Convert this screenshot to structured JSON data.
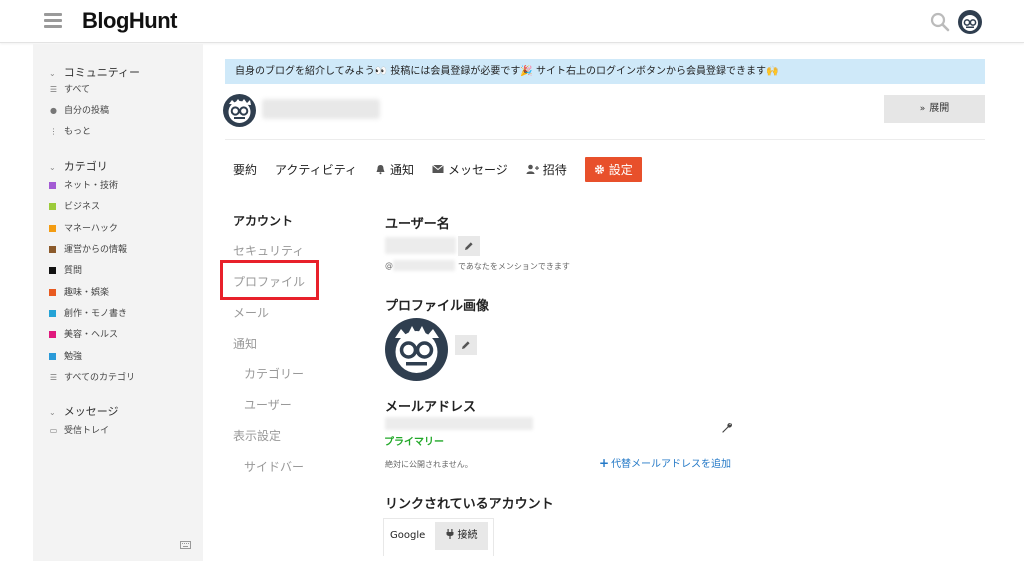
{
  "header": {
    "logo": "BlogHunt",
    "menu_icon": "hamburger-menu-icon",
    "search_icon": "search-icon",
    "avatar_icon": "owl-avatar-icon"
  },
  "sidebar": {
    "community": {
      "title": "コミュニティー",
      "items": [
        {
          "label": "すべて",
          "icon": "layers-icon"
        },
        {
          "label": "自分の投稿",
          "icon": "user-icon"
        },
        {
          "label": "もっと",
          "icon": "more-vertical-icon"
        }
      ]
    },
    "categories": {
      "title": "カテゴリ",
      "items": [
        {
          "label": "ネット・技術",
          "color": "#a35bd4"
        },
        {
          "label": "ビジネス",
          "color": "#9ccb3a"
        },
        {
          "label": "マネーハック",
          "color": "#f39c12"
        },
        {
          "label": "運営からの情報",
          "color": "#8b5a2b"
        },
        {
          "label": "質問",
          "color": "#111111"
        },
        {
          "label": "趣味・娯楽",
          "color": "#e85a20"
        },
        {
          "label": "創作・モノ書き",
          "color": "#25a3d6"
        },
        {
          "label": "美容・ヘルス",
          "color": "#e0197d"
        },
        {
          "label": "勉強",
          "color": "#2a9ad8"
        }
      ],
      "all_label": "すべてのカテゴリ"
    },
    "messages": {
      "title": "メッセージ",
      "items": [
        {
          "label": "受信トレイ",
          "icon": "inbox-icon"
        }
      ]
    }
  },
  "banner": {
    "text": "自身のブログを紹介してみよう👀 投稿には会員登録が必要です🎉 サイト右上のログインボタンから会員登録できます🙌"
  },
  "group": {
    "expand_label": "展開"
  },
  "tabs": [
    {
      "label": "要約",
      "icon": ""
    },
    {
      "label": "アクティビティ",
      "icon": ""
    },
    {
      "label": "通知",
      "icon": "bell-icon"
    },
    {
      "label": "メッセージ",
      "icon": "envelope-icon"
    },
    {
      "label": "招待",
      "icon": "user-plus-icon"
    },
    {
      "label": "設定",
      "icon": "gear-icon",
      "active": true
    }
  ],
  "settings_nav": {
    "account": "アカウント",
    "security": "セキュリティ",
    "profile": "プロファイル",
    "email": "メール",
    "notifications": "通知",
    "categories": "カテゴリー",
    "users": "ユーザー",
    "display": "表示設定",
    "sidebar": "サイドバー"
  },
  "settings": {
    "username_title": "ユーザー名",
    "mention_at": "@",
    "mention_hint": "であなたをメンションできます",
    "profile_image_title": "プロファイル画像",
    "email_title": "メールアドレス",
    "primary_label": "プライマリー",
    "private_note": "絶対に公開されません。",
    "add_email": "代替メールアドレスを追加",
    "linked_title": "リンクされているアカウント",
    "google_label": "Google",
    "connect_label": "接続"
  },
  "colors": {
    "accent": "#e8502b",
    "banner_bg": "#cfe9f9",
    "primary_green": "#22a829",
    "link_blue": "#2479c7",
    "highlight_red": "#e8202a"
  }
}
